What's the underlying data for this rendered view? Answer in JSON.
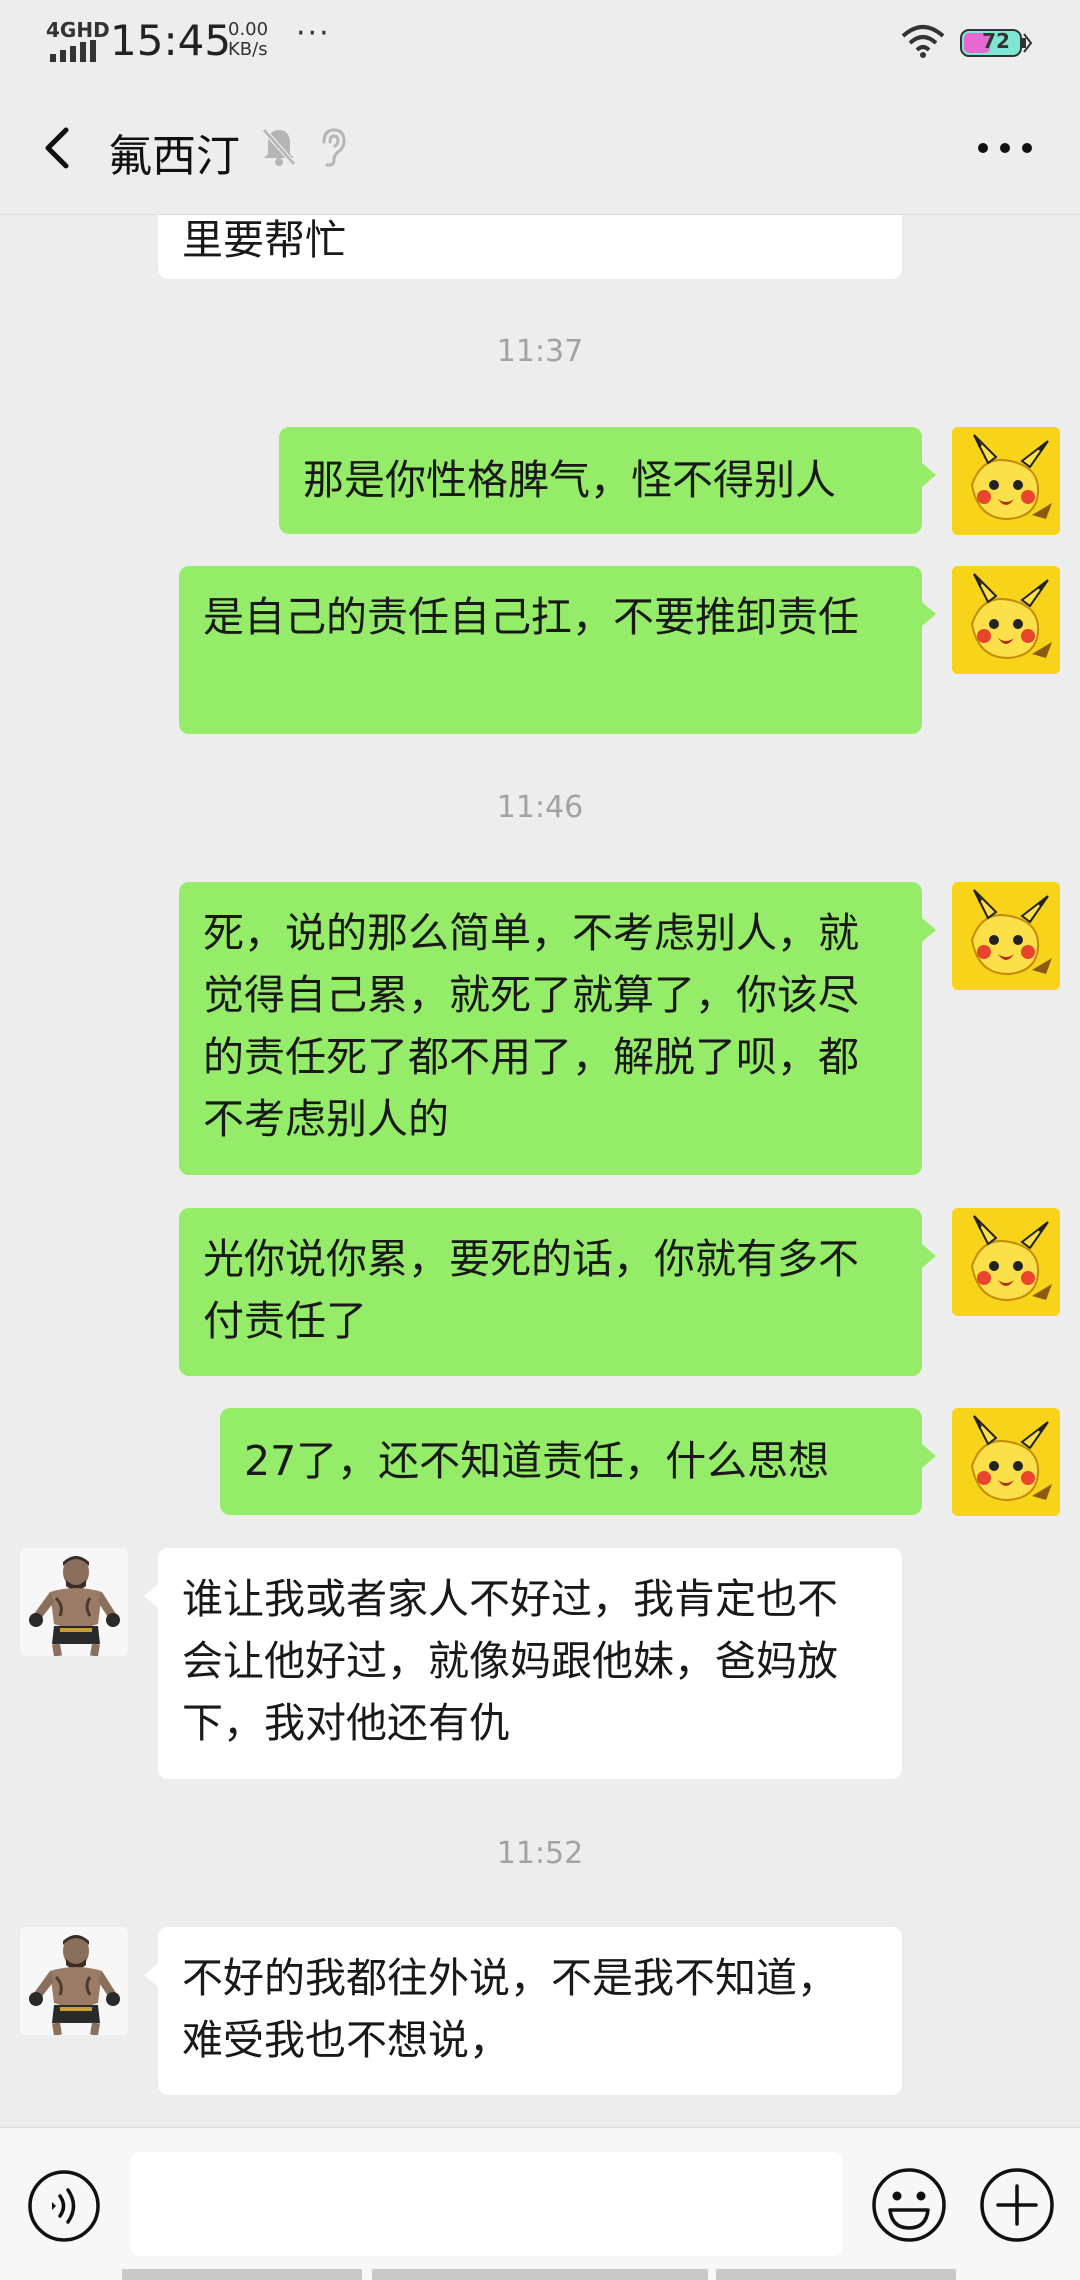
{
  "status_bar": {
    "network": "4GHD",
    "time": "15:45",
    "speed_value": "0.00",
    "speed_unit": "KB/s",
    "more": "···",
    "battery": "72"
  },
  "header": {
    "title": "氟西汀",
    "back_icon": "chevron-left-icon",
    "mute_icon": "bell-off-icon",
    "ear_icon": "ear-icon",
    "more_icon": "more-dots-icon"
  },
  "messages": {
    "partial_top": "里要帮忙",
    "time_1": "11:37",
    "m1": "那是你性格脾气，怪不得别人",
    "m2": "是自己的责任自己扛，不要推卸责任",
    "time_2": "11:46",
    "m3": "死，说的那么简单，不考虑别人，就觉得自己累，就死了就算了，你该尽的责任死了都不用了，解脱了呗，都不考虑别人的",
    "m4": "光你说你累，要死的话，你就有多不付责任了",
    "m5": "27了，还不知道责任，什么思想",
    "m6": "谁让我或者家人不好过，我肯定也不会让他好过，就像妈跟他妹，爸妈放下，我对他还有仇",
    "time_3": "11:52",
    "m7": "不好的我都往外说，不是我不知道，难受我也不想说，"
  },
  "input_bar": {
    "voice_icon": "voice-icon",
    "emoji_icon": "emoji-icon",
    "plus_icon": "plus-icon",
    "input_value": ""
  },
  "colors": {
    "outgoing_bubble": "#95ec69",
    "incoming_bubble": "#ffffff",
    "background": "#ededed"
  }
}
